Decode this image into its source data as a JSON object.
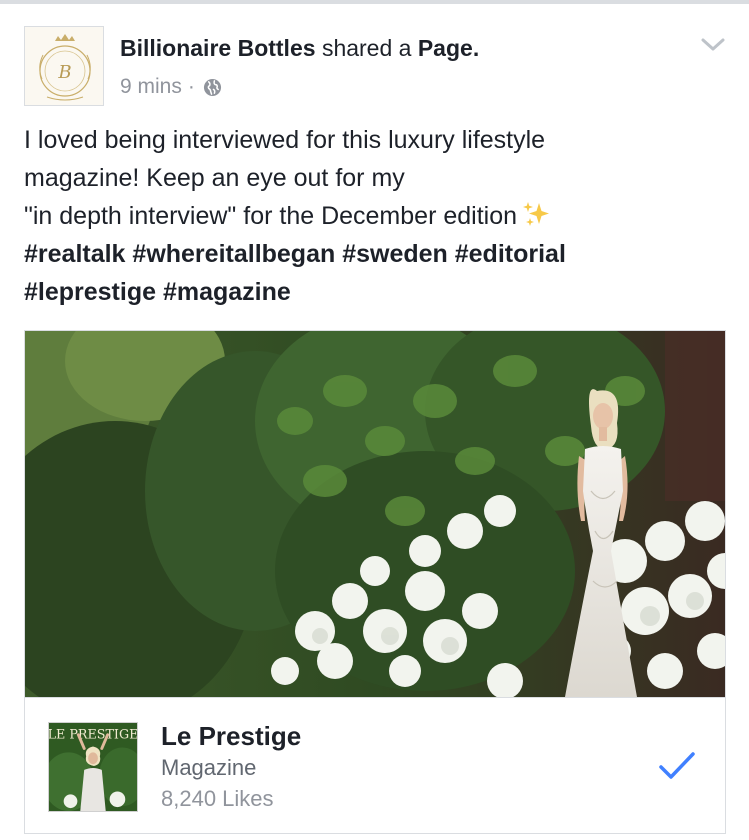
{
  "post": {
    "author": "Billionaire Bottles",
    "action": "shared a",
    "object": "Page.",
    "timestamp": "9 mins",
    "separator": "·",
    "privacy_icon": "globe-icon",
    "menu_icon": "chevron-down-icon",
    "text_lines": [
      "I loved being interviewed for this luxury lifestyle",
      "magazine! Keep an eye out for my",
      "\"in depth interview\" for the December edition"
    ],
    "emoji": "sparkles-icon",
    "hashtag_lines": [
      "#realtalk #whereitallbegan #sweden #editorial",
      "#leprestige #magazine"
    ]
  },
  "avatar": {
    "icon": "billionaire-bottles-logo",
    "logo_letter": "B"
  },
  "shared_page": {
    "name": "Le Prestige",
    "category": "Magazine",
    "likes": "8,240 Likes",
    "cover_masthead": "LE PRESTIGE",
    "liked_icon": "checkmark-icon"
  },
  "colors": {
    "text_primary": "#1d2129",
    "text_secondary": "#90949c",
    "link_blue": "#4080ff",
    "border": "#dadde1",
    "foliage_dark": "#2e4a1f",
    "hydrangea_white": "#f2f4ee"
  }
}
